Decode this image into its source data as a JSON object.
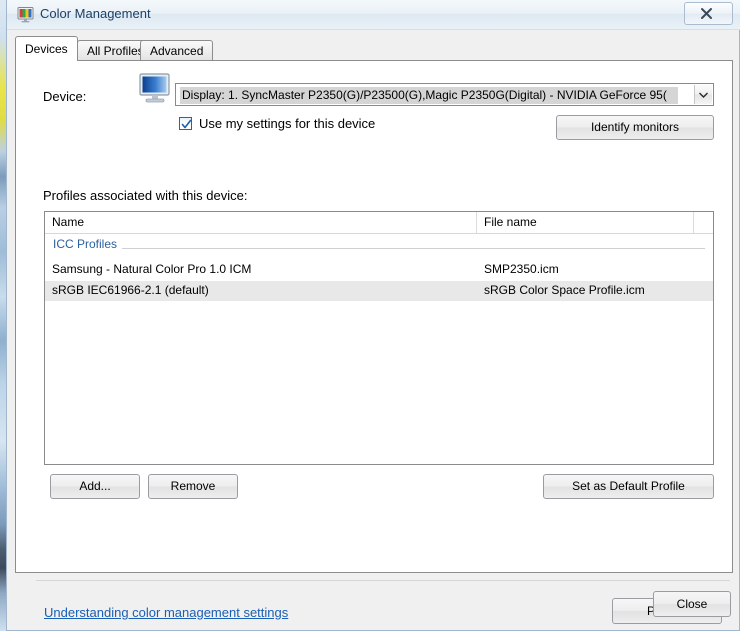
{
  "window": {
    "title": "Color Management",
    "icon": "color-monitor-icon",
    "close_icon": "close-x-icon"
  },
  "tabs": [
    {
      "label": "Devices",
      "active": true
    },
    {
      "label": "All Profiles",
      "active": false
    },
    {
      "label": "Advanced",
      "active": false
    }
  ],
  "device_section": {
    "label": "Device:",
    "icon": "monitor-icon",
    "combo_value": "Display: 1. SyncMaster P2350(G)/P23500(G),Magic P2350G(Digital) - NVIDIA GeForce 95(",
    "dropdown_icon": "chevron-down-icon",
    "checkbox": {
      "label": "Use my settings for this device",
      "checked": true
    },
    "identify_monitors_label": "Identify monitors"
  },
  "profiles_section": {
    "label": "Profiles associated with this device:",
    "columns": [
      "Name",
      "File name"
    ],
    "group_label": "ICC Profiles",
    "rows": [
      {
        "name": "Samsung - Natural Color Pro 1.0 ICM",
        "file": "SMP2350.icm",
        "selected": false
      },
      {
        "name": "sRGB IEC61966-2.1 (default)",
        "file": "sRGB Color Space Profile.icm",
        "selected": true
      }
    ],
    "add_label": "Add...",
    "remove_label": "Remove",
    "set_default_label": "Set as Default Profile"
  },
  "footer": {
    "help_link": "Understanding color management settings",
    "profiles_label": "Profiles",
    "close_label": "Close"
  },
  "colors": {
    "link": "#1a5fb4",
    "group_label": "#2b5f9e",
    "selected_row": "#e8e8e8",
    "title_text": "#1b3f66"
  }
}
